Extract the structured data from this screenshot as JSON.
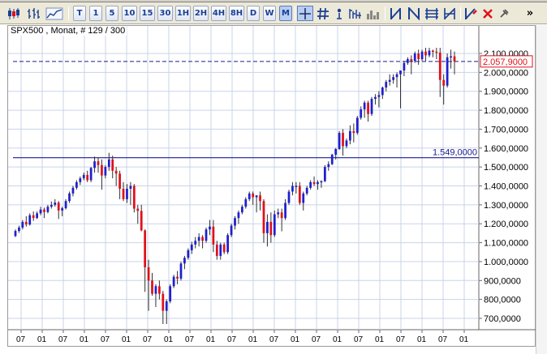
{
  "header": {
    "title": "SPX500 , Monat, # 129 / 300"
  },
  "toolbar": {
    "icons": [
      "candlestick-icon",
      "bar-chart-icon",
      "line-chart-icon"
    ],
    "timeframes": [
      "T",
      "1",
      "5",
      "10",
      "15",
      "30",
      "1H",
      "2H",
      "4H",
      "8H",
      "D",
      "W",
      "M"
    ],
    "active_timeframe": "M",
    "tools": [
      "crosshair-icon",
      "hash-grid-icon",
      "indicator-icon",
      "chart-options-icon",
      "volume-icon",
      "trendline-icon",
      "channel-icon",
      "fibonacci-icon",
      "gann-icon",
      "draw-icon",
      "delete-icon",
      "pin-icon"
    ],
    "more": "»"
  },
  "chart_data": {
    "type": "candlestick",
    "title": "SPX500 , Monat, # 129 / 300",
    "ylim": [
      650,
      2160
    ],
    "y_ticks": [
      "2.100,0000",
      "2.000,0000",
      "1.900,0000",
      "1.800,0000",
      "1.700,0000",
      "1.600,0000",
      "1.500,0000",
      "1.400,0000",
      "1.300,0000",
      "1.200,0000",
      "1.100,0000",
      "1.000,0000",
      "900,0000",
      "800,0000",
      "700,0000"
    ],
    "y_tick_values": [
      2100,
      2000,
      1900,
      1800,
      1700,
      1600,
      1500,
      1400,
      1300,
      1200,
      1100,
      1000,
      900,
      800,
      700
    ],
    "x_ticks": [
      "07",
      "01",
      "07",
      "01",
      "07",
      "01",
      "07",
      "01",
      "07",
      "01",
      "07",
      "01",
      "07",
      "01",
      "07",
      "01",
      "07",
      "01",
      "07",
      "01",
      "07",
      "01"
    ],
    "current_price": {
      "value": 2057.9,
      "label": "2.057,9000"
    },
    "horizontal_line": {
      "value": 1549,
      "label": "1.549,0000"
    },
    "colors": {
      "up": "#1f1fd0",
      "down": "#e0101a",
      "wick": "#303030",
      "grid": "#c9d3ea",
      "price_line": "#1b1b8f",
      "hline": "#1b1b8f",
      "price_box": "#e0101a"
    },
    "series": [
      {
        "values": [
          {
            "o": 1135,
            "h": 1170,
            "l": 1130,
            "c": 1162
          },
          {
            "o": 1162,
            "h": 1190,
            "l": 1152,
            "c": 1180
          },
          {
            "o": 1180,
            "h": 1220,
            "l": 1170,
            "c": 1210
          },
          {
            "o": 1210,
            "h": 1240,
            "l": 1185,
            "c": 1196
          },
          {
            "o": 1196,
            "h": 1255,
            "l": 1190,
            "c": 1245
          },
          {
            "o": 1245,
            "h": 1265,
            "l": 1215,
            "c": 1230
          },
          {
            "o": 1230,
            "h": 1265,
            "l": 1225,
            "c": 1255
          },
          {
            "o": 1255,
            "h": 1290,
            "l": 1245,
            "c": 1275
          },
          {
            "o": 1275,
            "h": 1285,
            "l": 1230,
            "c": 1262
          },
          {
            "o": 1262,
            "h": 1300,
            "l": 1255,
            "c": 1290
          },
          {
            "o": 1290,
            "h": 1318,
            "l": 1280,
            "c": 1300
          },
          {
            "o": 1300,
            "h": 1330,
            "l": 1290,
            "c": 1312
          },
          {
            "o": 1312,
            "h": 1320,
            "l": 1225,
            "c": 1270
          },
          {
            "o": 1270,
            "h": 1290,
            "l": 1240,
            "c": 1282
          },
          {
            "o": 1282,
            "h": 1330,
            "l": 1275,
            "c": 1320
          },
          {
            "o": 1320,
            "h": 1370,
            "l": 1310,
            "c": 1360
          },
          {
            "o": 1360,
            "h": 1400,
            "l": 1345,
            "c": 1390
          },
          {
            "o": 1390,
            "h": 1430,
            "l": 1380,
            "c": 1420
          },
          {
            "o": 1420,
            "h": 1450,
            "l": 1405,
            "c": 1440
          },
          {
            "o": 1440,
            "h": 1470,
            "l": 1430,
            "c": 1458
          },
          {
            "o": 1458,
            "h": 1480,
            "l": 1420,
            "c": 1430
          },
          {
            "o": 1430,
            "h": 1500,
            "l": 1420,
            "c": 1495
          },
          {
            "o": 1495,
            "h": 1555,
            "l": 1470,
            "c": 1530
          },
          {
            "o": 1530,
            "h": 1550,
            "l": 1470,
            "c": 1510
          },
          {
            "o": 1510,
            "h": 1540,
            "l": 1380,
            "c": 1455
          },
          {
            "o": 1455,
            "h": 1510,
            "l": 1440,
            "c": 1500
          },
          {
            "o": 1500,
            "h": 1575,
            "l": 1480,
            "c": 1540
          },
          {
            "o": 1540,
            "h": 1560,
            "l": 1440,
            "c": 1480
          },
          {
            "o": 1480,
            "h": 1500,
            "l": 1400,
            "c": 1465
          },
          {
            "o": 1465,
            "h": 1480,
            "l": 1330,
            "c": 1385
          },
          {
            "o": 1385,
            "h": 1420,
            "l": 1320,
            "c": 1330
          },
          {
            "o": 1330,
            "h": 1410,
            "l": 1310,
            "c": 1385
          },
          {
            "o": 1385,
            "h": 1420,
            "l": 1300,
            "c": 1400
          },
          {
            "o": 1400,
            "h": 1410,
            "l": 1260,
            "c": 1280
          },
          {
            "o": 1280,
            "h": 1300,
            "l": 1200,
            "c": 1268
          },
          {
            "o": 1268,
            "h": 1300,
            "l": 1160,
            "c": 1165
          },
          {
            "o": 1165,
            "h": 1170,
            "l": 840,
            "c": 970
          },
          {
            "o": 970,
            "h": 1010,
            "l": 740,
            "c": 900
          },
          {
            "o": 900,
            "h": 940,
            "l": 820,
            "c": 830
          },
          {
            "o": 830,
            "h": 880,
            "l": 760,
            "c": 870
          },
          {
            "o": 870,
            "h": 900,
            "l": 800,
            "c": 830
          },
          {
            "o": 830,
            "h": 845,
            "l": 670,
            "c": 740
          },
          {
            "o": 740,
            "h": 800,
            "l": 670,
            "c": 790
          },
          {
            "o": 790,
            "h": 880,
            "l": 780,
            "c": 870
          },
          {
            "o": 870,
            "h": 930,
            "l": 860,
            "c": 920
          },
          {
            "o": 920,
            "h": 950,
            "l": 880,
            "c": 910
          },
          {
            "o": 910,
            "h": 1000,
            "l": 900,
            "c": 990
          },
          {
            "o": 990,
            "h": 1030,
            "l": 960,
            "c": 1020
          },
          {
            "o": 1020,
            "h": 1070,
            "l": 1010,
            "c": 1060
          },
          {
            "o": 1060,
            "h": 1105,
            "l": 1040,
            "c": 1090
          },
          {
            "o": 1090,
            "h": 1130,
            "l": 1070,
            "c": 1110
          },
          {
            "o": 1110,
            "h": 1150,
            "l": 1080,
            "c": 1130
          },
          {
            "o": 1130,
            "h": 1140,
            "l": 1070,
            "c": 1110
          },
          {
            "o": 1110,
            "h": 1180,
            "l": 1100,
            "c": 1170
          },
          {
            "o": 1170,
            "h": 1220,
            "l": 1140,
            "c": 1185
          },
          {
            "o": 1185,
            "h": 1220,
            "l": 1050,
            "c": 1090
          },
          {
            "o": 1090,
            "h": 1110,
            "l": 1010,
            "c": 1030
          },
          {
            "o": 1030,
            "h": 1100,
            "l": 1010,
            "c": 1090
          },
          {
            "o": 1090,
            "h": 1100,
            "l": 1040,
            "c": 1050
          },
          {
            "o": 1050,
            "h": 1150,
            "l": 1040,
            "c": 1140
          },
          {
            "o": 1140,
            "h": 1200,
            "l": 1130,
            "c": 1190
          },
          {
            "o": 1190,
            "h": 1240,
            "l": 1170,
            "c": 1230
          },
          {
            "o": 1230,
            "h": 1270,
            "l": 1200,
            "c": 1260
          },
          {
            "o": 1260,
            "h": 1300,
            "l": 1250,
            "c": 1290
          },
          {
            "o": 1290,
            "h": 1340,
            "l": 1280,
            "c": 1330
          },
          {
            "o": 1330,
            "h": 1370,
            "l": 1320,
            "c": 1360
          },
          {
            "o": 1360,
            "h": 1370,
            "l": 1300,
            "c": 1340
          },
          {
            "o": 1340,
            "h": 1350,
            "l": 1260,
            "c": 1350
          },
          {
            "o": 1350,
            "h": 1370,
            "l": 1270,
            "c": 1320
          },
          {
            "o": 1320,
            "h": 1330,
            "l": 1100,
            "c": 1150
          },
          {
            "o": 1150,
            "h": 1250,
            "l": 1080,
            "c": 1210
          },
          {
            "o": 1210,
            "h": 1260,
            "l": 1100,
            "c": 1140
          },
          {
            "o": 1140,
            "h": 1270,
            "l": 1130,
            "c": 1250
          },
          {
            "o": 1250,
            "h": 1280,
            "l": 1230,
            "c": 1260
          },
          {
            "o": 1260,
            "h": 1280,
            "l": 1160,
            "c": 1230
          },
          {
            "o": 1230,
            "h": 1330,
            "l": 1220,
            "c": 1310
          },
          {
            "o": 1310,
            "h": 1380,
            "l": 1300,
            "c": 1370
          },
          {
            "o": 1370,
            "h": 1420,
            "l": 1350,
            "c": 1400
          },
          {
            "o": 1400,
            "h": 1420,
            "l": 1360,
            "c": 1400
          },
          {
            "o": 1400,
            "h": 1420,
            "l": 1300,
            "c": 1310
          },
          {
            "o": 1310,
            "h": 1370,
            "l": 1270,
            "c": 1360
          },
          {
            "o": 1360,
            "h": 1400,
            "l": 1350,
            "c": 1390
          },
          {
            "o": 1390,
            "h": 1430,
            "l": 1380,
            "c": 1420
          },
          {
            "o": 1420,
            "h": 1450,
            "l": 1400,
            "c": 1410
          },
          {
            "o": 1410,
            "h": 1430,
            "l": 1380,
            "c": 1420
          },
          {
            "o": 1420,
            "h": 1430,
            "l": 1390,
            "c": 1425
          },
          {
            "o": 1425,
            "h": 1510,
            "l": 1420,
            "c": 1500
          },
          {
            "o": 1500,
            "h": 1530,
            "l": 1480,
            "c": 1515
          },
          {
            "o": 1515,
            "h": 1570,
            "l": 1510,
            "c": 1565
          },
          {
            "o": 1565,
            "h": 1600,
            "l": 1540,
            "c": 1595
          },
          {
            "o": 1595,
            "h": 1690,
            "l": 1590,
            "c": 1680
          },
          {
            "o": 1680,
            "h": 1700,
            "l": 1560,
            "c": 1610
          },
          {
            "o": 1610,
            "h": 1650,
            "l": 1600,
            "c": 1640
          },
          {
            "o": 1640,
            "h": 1720,
            "l": 1620,
            "c": 1690
          },
          {
            "o": 1690,
            "h": 1730,
            "l": 1630,
            "c": 1680
          },
          {
            "o": 1680,
            "h": 1770,
            "l": 1670,
            "c": 1760
          },
          {
            "o": 1760,
            "h": 1820,
            "l": 1750,
            "c": 1805
          },
          {
            "o": 1805,
            "h": 1850,
            "l": 1760,
            "c": 1840
          },
          {
            "o": 1840,
            "h": 1850,
            "l": 1740,
            "c": 1780
          },
          {
            "o": 1780,
            "h": 1870,
            "l": 1770,
            "c": 1860
          },
          {
            "o": 1860,
            "h": 1885,
            "l": 1830,
            "c": 1870
          },
          {
            "o": 1870,
            "h": 1900,
            "l": 1815,
            "c": 1880
          },
          {
            "o": 1880,
            "h": 1925,
            "l": 1860,
            "c": 1920
          },
          {
            "o": 1920,
            "h": 1960,
            "l": 1900,
            "c": 1950
          },
          {
            "o": 1950,
            "h": 1990,
            "l": 1930,
            "c": 1960
          },
          {
            "o": 1960,
            "h": 1990,
            "l": 1940,
            "c": 1975
          },
          {
            "o": 1975,
            "h": 2000,
            "l": 1920,
            "c": 1990
          },
          {
            "o": 1990,
            "h": 2010,
            "l": 1810,
            "c": 2010
          },
          {
            "o": 2010,
            "h": 2060,
            "l": 1980,
            "c": 2050
          },
          {
            "o": 2050,
            "h": 2080,
            "l": 2040,
            "c": 2070
          },
          {
            "o": 2070,
            "h": 2090,
            "l": 1990,
            "c": 2060
          },
          {
            "o": 2060,
            "h": 2110,
            "l": 2050,
            "c": 2100
          },
          {
            "o": 2100,
            "h": 2120,
            "l": 2040,
            "c": 2070
          },
          {
            "o": 2070,
            "h": 2120,
            "l": 2060,
            "c": 2110
          },
          {
            "o": 2110,
            "h": 2130,
            "l": 2060,
            "c": 2090
          },
          {
            "o": 2090,
            "h": 2130,
            "l": 2080,
            "c": 2115
          },
          {
            "o": 2115,
            "h": 2120,
            "l": 2080,
            "c": 2110
          },
          {
            "o": 2110,
            "h": 2130,
            "l": 2070,
            "c": 2105
          },
          {
            "o": 2105,
            "h": 2130,
            "l": 1870,
            "c": 1960
          },
          {
            "o": 1960,
            "h": 1990,
            "l": 1830,
            "c": 1930
          },
          {
            "o": 1930,
            "h": 2100,
            "l": 1920,
            "c": 2080
          },
          {
            "o": 2080,
            "h": 2120,
            "l": 2020,
            "c": 2085
          },
          {
            "o": 2085,
            "h": 2110,
            "l": 1990,
            "c": 2057.9
          }
        ]
      }
    ]
  }
}
